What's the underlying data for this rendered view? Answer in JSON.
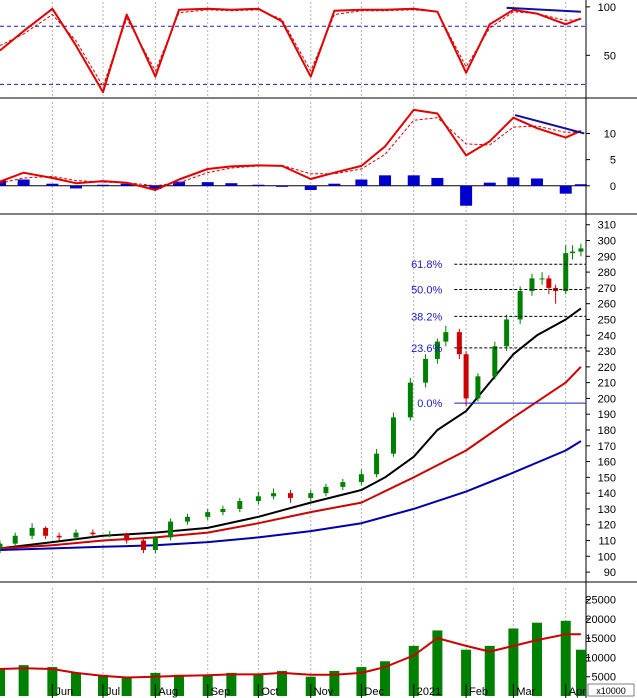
{
  "chart_data": [
    {
      "type": "line",
      "panel": "stochastic",
      "yticks": [
        50,
        100
      ],
      "ylim": [
        8,
        105
      ],
      "dashed_levels": [
        80,
        20
      ],
      "x": [
        "2020-05-01",
        "2020-05-15",
        "2020-06-01",
        "2020-06-15",
        "2020-07-01",
        "2020-07-15",
        "2020-08-01",
        "2020-08-15",
        "2020-09-01",
        "2020-09-15",
        "2020-10-01",
        "2020-10-15",
        "2020-11-01",
        "2020-11-15",
        "2020-12-01",
        "2020-12-15",
        "2021-01-01",
        "2021-01-15",
        "2021-02-01",
        "2021-02-15",
        "2021-03-01",
        "2021-03-15",
        "2021-04-01",
        "2021-04-10"
      ],
      "series": [
        {
          "color": "#e00000",
          "style": "solid",
          "values": [
            55,
            75,
            98,
            60,
            12,
            92,
            28,
            97,
            98,
            97,
            98,
            85,
            28,
            96,
            97,
            97,
            98,
            95,
            32,
            82,
            97,
            93,
            82,
            88
          ]
        },
        {
          "color": "#e00000",
          "style": "dashed",
          "values": [
            60,
            72,
            92,
            65,
            18,
            88,
            34,
            94,
            97,
            96,
            97,
            87,
            34,
            92,
            96,
            96,
            97,
            95,
            38,
            78,
            95,
            93,
            86,
            87
          ]
        }
      ],
      "trendline": {
        "color": "#1010a0",
        "x": [
          "2021-02-25",
          "2021-04-10"
        ],
        "y": [
          99,
          95
        ]
      }
    },
    {
      "type": "bar",
      "panel": "macd",
      "yticks": [
        0,
        5,
        10
      ],
      "ylim": [
        -5,
        16
      ],
      "x": [
        "2020-05-01",
        "2020-05-15",
        "2020-06-01",
        "2020-06-15",
        "2020-07-01",
        "2020-07-15",
        "2020-08-01",
        "2020-08-15",
        "2020-09-01",
        "2020-09-15",
        "2020-10-01",
        "2020-10-15",
        "2020-11-01",
        "2020-11-15",
        "2020-12-01",
        "2020-12-15",
        "2021-01-01",
        "2021-01-15",
        "2021-02-01",
        "2021-02-15",
        "2021-03-01",
        "2021-03-15",
        "2021-04-01",
        "2021-04-10"
      ],
      "series": [
        {
          "name": "histogram",
          "color": "#0000cc",
          "style": "bar",
          "values": [
            1.0,
            1.2,
            0.4,
            -0.5,
            0.2,
            0.4,
            -0.6,
            0.8,
            0.7,
            0.5,
            0.2,
            -0.2,
            -0.8,
            0.4,
            1.2,
            2.0,
            2.0,
            1.5,
            -3.8,
            0.6,
            1.6,
            1.4,
            -1.5,
            0.3
          ]
        },
        {
          "name": "macd",
          "color": "#e00000",
          "style": "solid",
          "values": [
            0.8,
            2.5,
            1.5,
            0.5,
            0.9,
            0.6,
            -0.8,
            1.2,
            3.2,
            3.7,
            3.9,
            3.8,
            1.3,
            2.5,
            3.8,
            7.5,
            14.5,
            13.8,
            5.8,
            8.5,
            13.0,
            11.0,
            9.2,
            10.5
          ]
        },
        {
          "name": "signal",
          "color": "#e00000",
          "style": "dashed",
          "values": [
            0.5,
            1.5,
            1.8,
            1.0,
            0.7,
            0.6,
            0.0,
            0.6,
            2.5,
            3.4,
            3.8,
            3.9,
            2.3,
            2.3,
            3.2,
            6.0,
            12.5,
            13.0,
            8.0,
            7.8,
            11.2,
            11.4,
            10.2,
            10.3
          ]
        }
      ],
      "trendline": {
        "color": "#1010a0",
        "x": [
          "2021-03-02",
          "2021-04-12"
        ],
        "y": [
          13.5,
          10.0
        ]
      }
    },
    {
      "type": "line",
      "panel": "price",
      "yticks": [
        90,
        100,
        110,
        120,
        130,
        140,
        150,
        160,
        170,
        180,
        190,
        200,
        210,
        220,
        230,
        240,
        250,
        260,
        270,
        280,
        290,
        300,
        310
      ],
      "ylim": [
        85,
        313
      ],
      "candles": {
        "up_color": "#008000",
        "down_color": "#cc0000",
        "x": [
          "2020-05-01",
          "2020-05-10",
          "2020-05-20",
          "2020-05-28",
          "2020-06-05",
          "2020-06-15",
          "2020-06-25",
          "2020-07-05",
          "2020-07-15",
          "2020-07-25",
          "2020-08-01",
          "2020-08-10",
          "2020-08-20",
          "2020-09-01",
          "2020-09-10",
          "2020-09-20",
          "2020-10-01",
          "2020-10-10",
          "2020-10-20",
          "2020-11-01",
          "2020-11-10",
          "2020-11-20",
          "2020-12-01",
          "2020-12-10",
          "2020-12-20",
          "2020-12-30",
          "2021-01-08",
          "2021-01-15",
          "2021-01-20",
          "2021-01-28",
          "2021-02-01",
          "2021-02-08",
          "2021-02-18",
          "2021-02-25",
          "2021-03-05",
          "2021-03-12",
          "2021-03-18",
          "2021-03-22",
          "2021-03-26",
          "2021-04-01",
          "2021-04-05",
          "2021-04-10"
        ],
        "open": [
          105,
          108,
          113,
          118,
          113,
          112,
          115,
          114,
          114,
          110,
          104,
          112,
          122,
          125,
          128,
          130,
          135,
          138,
          140,
          137,
          140,
          144,
          147,
          152,
          165,
          188,
          210,
          225,
          236,
          242,
          228,
          200,
          214,
          233,
          250,
          268,
          276,
          276,
          270,
          268,
          292,
          293
        ],
        "close": [
          108,
          113,
          118,
          113,
          112,
          115,
          114,
          114,
          110,
          104,
          112,
          122,
          125,
          128,
          130,
          135,
          138,
          140,
          137,
          140,
          144,
          147,
          152,
          165,
          188,
          210,
          225,
          236,
          242,
          228,
          200,
          214,
          233,
          250,
          268,
          276,
          276,
          270,
          268,
          292,
          293,
          295
        ],
        "high": [
          110,
          115,
          121,
          119,
          115,
          117,
          117,
          116,
          115,
          111,
          113,
          124,
          127,
          130,
          132,
          137,
          141,
          143,
          142,
          142,
          146,
          149,
          155,
          168,
          191,
          213,
          228,
          238,
          246,
          244,
          230,
          216,
          236,
          253,
          271,
          279,
          280,
          278,
          272,
          297,
          297,
          298
        ],
        "low": [
          102,
          106,
          111,
          111,
          110,
          110,
          112,
          112,
          108,
          102,
          102,
          110,
          120,
          123,
          126,
          128,
          133,
          136,
          134,
          135,
          138,
          142,
          145,
          150,
          163,
          186,
          207,
          222,
          233,
          225,
          195,
          198,
          212,
          230,
          247,
          265,
          272,
          266,
          260,
          266,
          288,
          290
        ]
      },
      "series": [
        {
          "color": "#000000",
          "style": "solid",
          "x": [
            "2020-05-01",
            "2020-06-01",
            "2020-07-01",
            "2020-08-01",
            "2020-09-01",
            "2020-10-01",
            "2020-11-01",
            "2020-12-01",
            "2020-12-15",
            "2021-01-01",
            "2021-01-15",
            "2021-02-01",
            "2021-02-15",
            "2021-03-01",
            "2021-03-15",
            "2021-04-01",
            "2021-04-10"
          ],
          "values": [
            105,
            109,
            113,
            115,
            118,
            125,
            134,
            142,
            150,
            163,
            180,
            192,
            210,
            228,
            240,
            250,
            257
          ]
        },
        {
          "color": "#cc0000",
          "style": "solid",
          "x": [
            "2020-05-01",
            "2020-06-01",
            "2020-07-01",
            "2020-08-01",
            "2020-09-01",
            "2020-10-01",
            "2020-11-01",
            "2020-12-01",
            "2021-01-01",
            "2021-02-01",
            "2021-03-01",
            "2021-04-01",
            "2021-04-10"
          ],
          "values": [
            105,
            107,
            110,
            112,
            115,
            121,
            128,
            134,
            150,
            167,
            188,
            210,
            220
          ]
        },
        {
          "color": "#0000aa",
          "style": "solid",
          "x": [
            "2020-05-01",
            "2020-06-01",
            "2020-07-01",
            "2020-08-01",
            "2020-09-01",
            "2020-10-01",
            "2020-11-01",
            "2020-12-01",
            "2021-01-01",
            "2021-02-01",
            "2021-03-01",
            "2021-04-01",
            "2021-04-10"
          ],
          "values": [
            104,
            105,
            106,
            107,
            109,
            112,
            116,
            121,
            130,
            141,
            153,
            167,
            173
          ]
        }
      ],
      "fibonacci": {
        "color": "#1a1acc",
        "levels": [
          {
            "label": "61.8%",
            "value": 285
          },
          {
            "label": "50.0%",
            "value": 269
          },
          {
            "label": "38.2%",
            "value": 252
          },
          {
            "label": "23.6%",
            "value": 232
          },
          {
            "label": "0.0%",
            "value": 197
          }
        ],
        "x_start": "2021-01-25"
      }
    },
    {
      "type": "bar",
      "panel": "volume",
      "yticks": [
        5000,
        10000,
        15000,
        20000,
        25000
      ],
      "ylim": [
        0,
        28000
      ],
      "unit_label": "x10000",
      "bar_color": "#008000",
      "x": [
        "2020-05-01",
        "2020-05-15",
        "2020-06-01",
        "2020-06-15",
        "2020-07-01",
        "2020-07-15",
        "2020-08-01",
        "2020-08-15",
        "2020-09-01",
        "2020-09-15",
        "2020-10-01",
        "2020-10-15",
        "2020-11-01",
        "2020-11-15",
        "2020-12-01",
        "2020-12-15",
        "2021-01-01",
        "2021-01-15",
        "2021-02-01",
        "2021-02-15",
        "2021-03-01",
        "2021-03-15",
        "2021-04-01",
        "2021-04-10"
      ],
      "values": [
        7000,
        8000,
        7500,
        6000,
        5500,
        5000,
        6000,
        5500,
        5500,
        6000,
        5500,
        6500,
        5000,
        6500,
        7500,
        9000,
        13000,
        17000,
        12000,
        13000,
        17500,
        19000,
        19500,
        12000
      ],
      "series": [
        {
          "color": "#cc0000",
          "style": "solid",
          "values": [
            7000,
            7200,
            7000,
            6000,
            5200,
            4800,
            5000,
            5200,
            5400,
            5600,
            5600,
            6000,
            5500,
            5500,
            6000,
            7500,
            10500,
            15000,
            13000,
            11500,
            13000,
            14500,
            16000,
            16000
          ]
        }
      ]
    }
  ],
  "x_axis": {
    "labels": [
      "Jun",
      "Jul",
      "Aug",
      "Sep",
      "Oct",
      "Nov",
      "Dec",
      "2021",
      "Feb",
      "Mar",
      "Apr"
    ],
    "dates": [
      "2020-06-01",
      "2020-07-01",
      "2020-08-01",
      "2020-09-01",
      "2020-10-01",
      "2020-11-01",
      "2020-12-01",
      "2021-01-01",
      "2021-02-01",
      "2021-03-01",
      "2021-04-01"
    ],
    "start": "2020-05-01",
    "end": "2021-04-13"
  }
}
